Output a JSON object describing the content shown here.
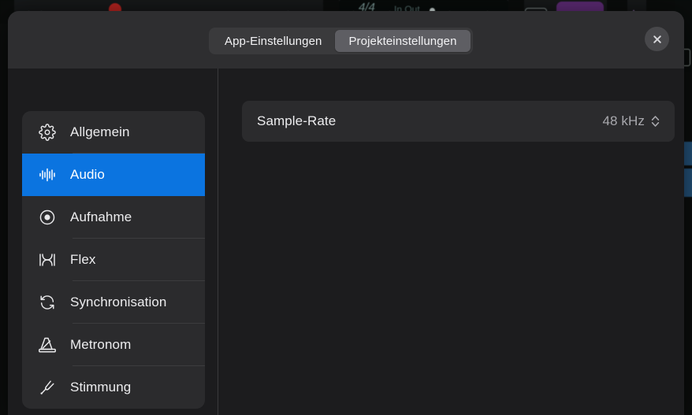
{
  "background": {
    "app_name": "logic-pro-toolbar",
    "time_signature": "4/4",
    "in_out_label": "In  Out",
    "accent_purple": "#5b2a72",
    "accent_red": "#b4231f",
    "lcd_text_color": "#5d7a78"
  },
  "header": {
    "segmented_control": {
      "options": [
        {
          "label": "App-Einstellungen",
          "active": false
        },
        {
          "label": "Projekteinstellungen",
          "active": true
        }
      ]
    },
    "close_button_label": "Schließen",
    "close_icon": "close-icon"
  },
  "sidebar": {
    "items": [
      {
        "label": "Allgemein",
        "icon": "gear-icon",
        "selected": false
      },
      {
        "label": "Audio",
        "icon": "waveform-icon",
        "selected": true
      },
      {
        "label": "Aufnahme",
        "icon": "record-icon",
        "selected": false
      },
      {
        "label": "Flex",
        "icon": "flex-icon",
        "selected": false
      },
      {
        "label": "Synchronisation",
        "icon": "sync-icon",
        "selected": false
      },
      {
        "label": "Metronom",
        "icon": "metronome-icon",
        "selected": false
      },
      {
        "label": "Stimmung",
        "icon": "tuning-fork-icon",
        "selected": false
      }
    ],
    "selected_color": "#0b74e0"
  },
  "content": {
    "settings": [
      {
        "label": "Sample-Rate",
        "value": "48 kHz",
        "control": "stepper",
        "stepper_icon": "chevron-up-down-icon"
      }
    ]
  },
  "colors": {
    "panel_bg": "#1c1c1e",
    "header_bg": "#2e2e30",
    "row_bg": "#2b2b2d",
    "accent_blue": "#0b74e0",
    "text_primary": "#ececee",
    "text_secondary": "#a8a8ad"
  }
}
